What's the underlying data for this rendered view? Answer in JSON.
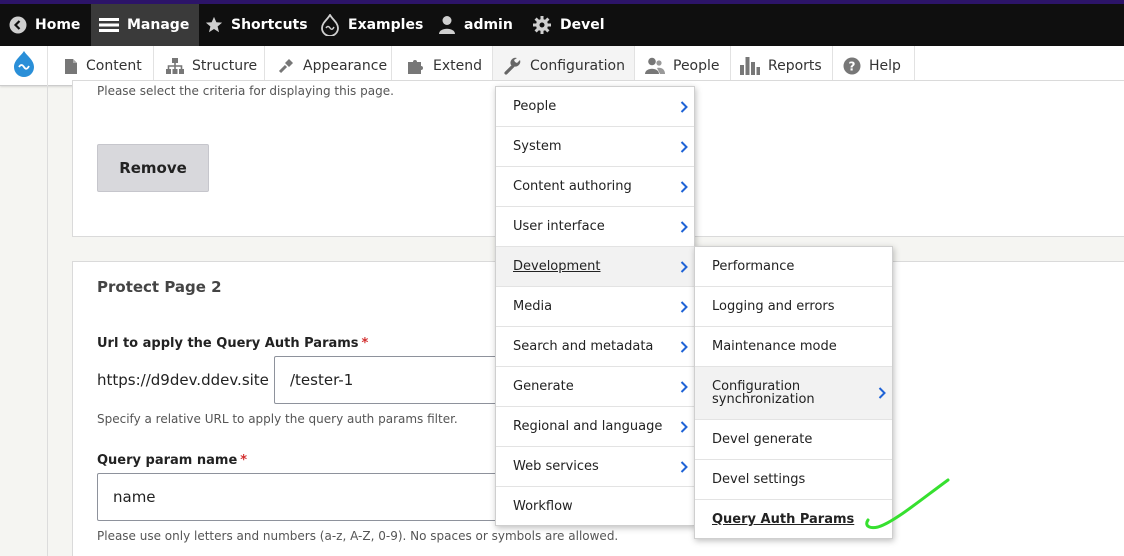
{
  "toolbar": {
    "home": "Home",
    "manage": "Manage",
    "shortcuts": "Shortcuts",
    "examples": "Examples",
    "admin": "admin",
    "devel": "Devel"
  },
  "tray": {
    "content": "Content",
    "structure": "Structure",
    "appearance": "Appearance",
    "extend": "Extend",
    "configuration": "Configuration",
    "people": "People",
    "reports": "Reports",
    "help": "Help"
  },
  "page": {
    "criteria_desc": "Please select the criteria for displaying this page.",
    "remove_label": "Remove",
    "section2_title": "Protect Page 2",
    "url_label": "Url to apply the Query Auth Params",
    "url_prefix": "https://d9dev.ddev.site",
    "url_value": "/tester-1",
    "url_desc": "Specify a relative URL to apply the query auth params filter.",
    "param_label": "Query param name",
    "param_value": "name",
    "param_desc": "Please use only letters and numbers (a-z, A-Z, 0-9). No spaces or symbols are allowed.",
    "required_mark": "*"
  },
  "config_menu": [
    {
      "label": "People"
    },
    {
      "label": "System"
    },
    {
      "label": "Content authoring"
    },
    {
      "label": "User interface"
    },
    {
      "label": "Development"
    },
    {
      "label": "Media"
    },
    {
      "label": "Search and metadata"
    },
    {
      "label": "Generate"
    },
    {
      "label": "Regional and language"
    },
    {
      "label": "Web services"
    },
    {
      "label": "Workflow"
    }
  ],
  "dev_menu": [
    {
      "label": "Performance"
    },
    {
      "label": "Logging and errors"
    },
    {
      "label": "Maintenance mode"
    },
    {
      "label": "Configuration synchronization"
    },
    {
      "label": "Devel generate"
    },
    {
      "label": "Devel settings"
    },
    {
      "label": "Query Auth Params"
    }
  ],
  "colors": {
    "toolbar_bg": "#0f0f0f",
    "accent_border": "#2c1468",
    "chevron": "#1f63d6",
    "required": "#d32f2f",
    "checkmark": "#36e02f"
  },
  "icons": [
    "drupal-logo-icon",
    "chevron-left-circle-icon",
    "hamburger-icon",
    "star-icon",
    "drop-icon",
    "user-icon",
    "gear-icon",
    "document-icon",
    "structure-icon",
    "brush-icon",
    "puzzle-icon",
    "wrench-icon",
    "people-icon",
    "bar-chart-icon",
    "help-icon",
    "chevron-right-icon",
    "checkmark-annotation"
  ]
}
